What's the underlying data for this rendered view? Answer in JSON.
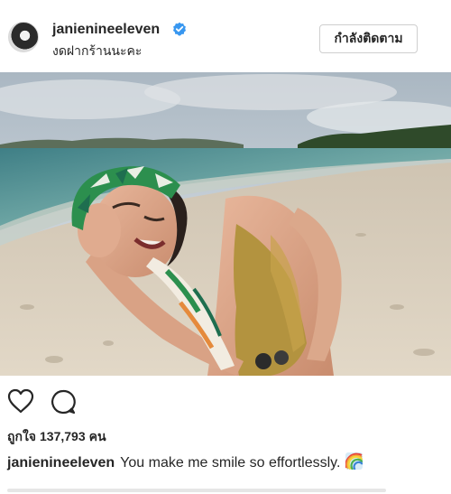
{
  "post": {
    "username": "janienineeleven",
    "subtitle": "งดฝากร้านนะคะ",
    "follow_label": "กำลังติดตาม"
  },
  "likes": {
    "prefix": "ถูกใจ",
    "count": "137,793",
    "suffix": "คน"
  },
  "caption": {
    "username": "janienineeleven",
    "text": "You make me smile so effortlessly."
  },
  "icons": {
    "avatar": "avatar",
    "verified": "verified-badge-icon",
    "like": "heart-icon",
    "comment": "comment-bubble-icon",
    "emoji": "rainbow-icon"
  },
  "colors": {
    "verified_blue": "#3897f0",
    "text": "#262626",
    "button_border": "#cfcfcf"
  }
}
